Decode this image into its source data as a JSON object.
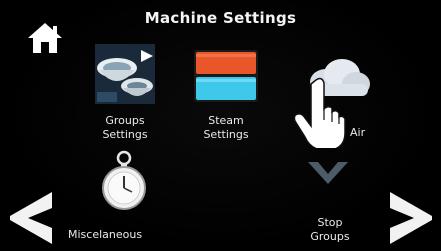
{
  "header": {
    "title": "Machine Settings"
  },
  "tiles": {
    "groups": {
      "line1": "Groups",
      "line2": "Settings",
      "icon": "cups-icon"
    },
    "steam": {
      "line1": "Steam",
      "line2": "Settings",
      "icon": "steam-panel-icon"
    },
    "air": {
      "label": "Air",
      "icon": "cloud-icon"
    },
    "misc": {
      "label": "Miscelaneous",
      "icon": "stopwatch-icon"
    },
    "stop_groups": {
      "line1": "Stop",
      "line2": "Groups",
      "icon": "chevron-down-icon"
    }
  },
  "nav": {
    "prev": "chevron-left-icon",
    "next": "chevron-right-icon",
    "home": "home-icon"
  },
  "colors": {
    "background": "#000000",
    "steam_top": "#e8562a",
    "steam_bottom": "#3ec8ea",
    "text": "#ffffff"
  }
}
